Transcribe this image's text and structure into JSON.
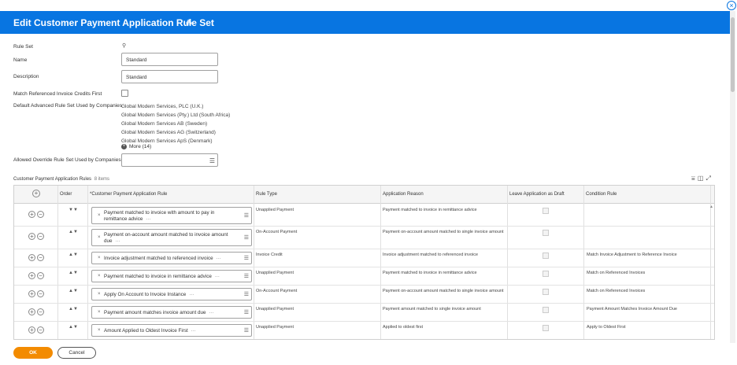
{
  "header": {
    "title": "Edit Customer Payment Application Rule Set",
    "icon": "related-actions-icon"
  },
  "form": {
    "rule_set_label": "Rule Set",
    "name_label": "Name",
    "name_value": "Standard",
    "description_label": "Description",
    "description_value": "Standard",
    "match_label": "Match Referenced Invoice Credits First",
    "default_label": "Default Advanced Rule Set Used by Companies",
    "companies": [
      "Global Modern Services, PLC (U.K.)",
      "Global Modern Services (Pty.) Ltd (South Africa)",
      "Global Modern Services AB (Sweden)",
      "Global Modern Services AG (Switzerland)",
      "Global Modern Services ApS (Denmark)"
    ],
    "more_label": "More (14)",
    "override_label": "Allowed Override Rule Set Used by Companies"
  },
  "table": {
    "caption": "Customer Payment Application Rules",
    "count": "8 items",
    "headers": {
      "order": "Order",
      "rule": "*Customer Payment Application Rule",
      "type": "Rule Type",
      "reason": "Application Reason",
      "draft": "Leave Application as Draft",
      "condition": "Condition Rule"
    },
    "rows": [
      {
        "rule": "Payment matched to invoice with amount to pay in remittance advice",
        "type": "Unapplied Payment",
        "reason": "Payment matched to invoice in remittance advice",
        "condition": ""
      },
      {
        "rule": "Payment on-account amount matched to invoice amount due",
        "type": "On-Account Payment",
        "reason": "Payment on-account amount matched to single invoice amount",
        "condition": ""
      },
      {
        "rule": "Invoice adjustment matched to referenced invoice",
        "type": "Invoice Credit",
        "reason": "Invoice adjustment matched to referenced invoice",
        "condition": "Match Invoice Adjustment to Reference Invoice"
      },
      {
        "rule": "Payment matched to invoice in remittance advice",
        "type": "Unapplied Payment",
        "reason": "Payment matched to invoice in remittance advice",
        "condition": "Match on Referenced Invoices"
      },
      {
        "rule": "Apply On Account to Invoice Instance",
        "type": "On-Account Payment",
        "reason": "Payment on-account amount matched to single invoice amount",
        "condition": "Match on Referenced Invoices"
      },
      {
        "rule": "Payment amount matches invoice amount due",
        "type": "Unapplied Payment",
        "reason": "Payment amount matched to single invoice amount",
        "condition": "Payment Amount Matches Invoice Amount Due"
      },
      {
        "rule": "Amount Applied to Oldest Invoice First",
        "type": "Unapplied Payment",
        "reason": "Applied to oldest first",
        "condition": "Apply to Oldest First"
      }
    ]
  },
  "footer": {
    "ok_label": "OK",
    "cancel_label": "Cancel"
  }
}
